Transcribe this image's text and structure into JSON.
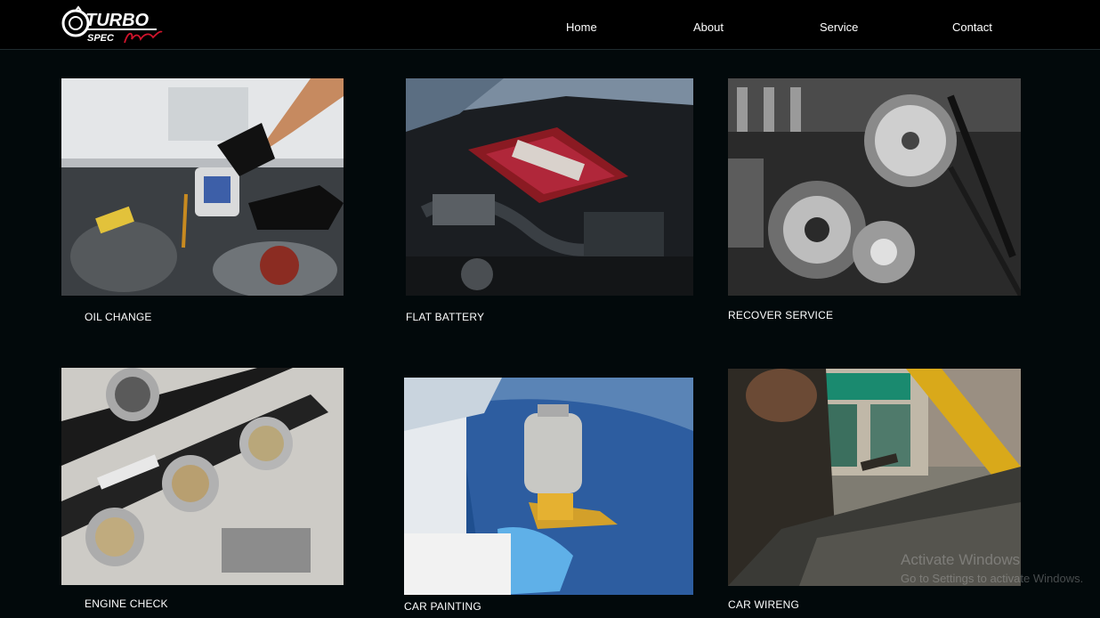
{
  "header": {
    "logo_text": "TURBO SPEC Auto",
    "nav": [
      "Home",
      "About",
      "Service",
      "Contact"
    ]
  },
  "services": [
    {
      "label": "OIL CHANGE",
      "image": "oil-change-photo"
    },
    {
      "label": "FLAT BATTERY",
      "image": "engine-bay-photo"
    },
    {
      "label": "RECOVER SERVICE",
      "image": "chrome-engine-photo"
    },
    {
      "label": "ENGINE CHECK",
      "image": "throttle-body-photo"
    },
    {
      "label": "CAR PAINTING",
      "image": "spray-gun-photo"
    },
    {
      "label": "CAR WIRENG",
      "image": "mechanic-hood-photo"
    }
  ],
  "watermark": {
    "title": "Activate Windows",
    "subtitle": "Go to Settings to activate Windows."
  },
  "colors": {
    "background": "#02090b",
    "navbar": "#000000",
    "text": "#ffffff",
    "logo_accent": "#d0142c"
  }
}
